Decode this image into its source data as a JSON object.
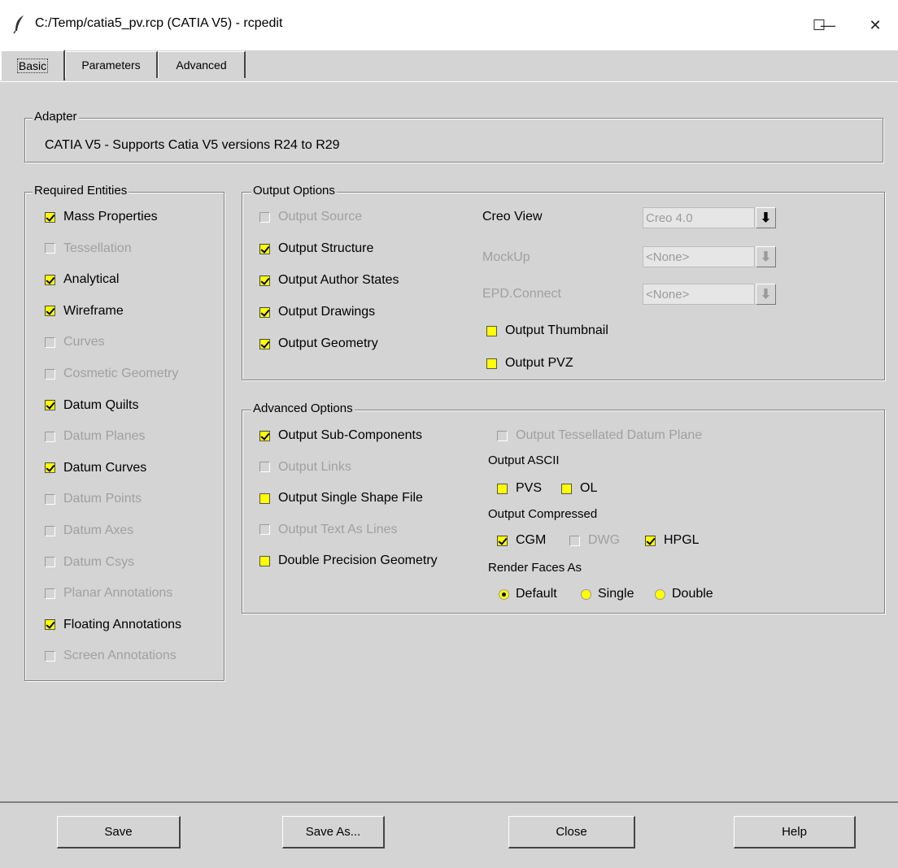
{
  "window": {
    "title": "C:/Temp/catia5_pv.rcp (CATIA V5) - rcpedit",
    "minimize": "—",
    "maximize": "☐",
    "close": "✕"
  },
  "tabs": [
    "Basic",
    "Parameters",
    "Advanced"
  ],
  "active_tab": "Basic",
  "adapter": {
    "label": "Adapter",
    "text": "CATIA V5  -  Supports Catia V5 versions R24 to R29"
  },
  "required_entities": {
    "label": "Required Entities",
    "items": [
      {
        "label": "Mass Properties",
        "checked": true,
        "enabled": true
      },
      {
        "label": "Tessellation",
        "checked": false,
        "enabled": false
      },
      {
        "label": "Analytical",
        "checked": true,
        "enabled": true
      },
      {
        "label": "Wireframe",
        "checked": true,
        "enabled": true
      },
      {
        "label": "Curves",
        "checked": false,
        "enabled": false
      },
      {
        "label": "Cosmetic Geometry",
        "checked": false,
        "enabled": false
      },
      {
        "label": "Datum Quilts",
        "checked": true,
        "enabled": true
      },
      {
        "label": "Datum Planes",
        "checked": false,
        "enabled": false
      },
      {
        "label": "Datum Curves",
        "checked": true,
        "enabled": true
      },
      {
        "label": "Datum Points",
        "checked": false,
        "enabled": false
      },
      {
        "label": "Datum Axes",
        "checked": false,
        "enabled": false
      },
      {
        "label": "Datum Csys",
        "checked": false,
        "enabled": false
      },
      {
        "label": "Planar Annotations",
        "checked": false,
        "enabled": false
      },
      {
        "label": "Floating Annotations",
        "checked": true,
        "enabled": true
      },
      {
        "label": "Screen Annotations",
        "checked": false,
        "enabled": false
      }
    ]
  },
  "output_options": {
    "label": "Output Options",
    "items": [
      {
        "label": "Output Source",
        "checked": false,
        "enabled": false
      },
      {
        "label": "Output Structure",
        "checked": true,
        "enabled": true
      },
      {
        "label": "Output Author States",
        "checked": true,
        "enabled": true
      },
      {
        "label": "Output Drawings",
        "checked": true,
        "enabled": true
      },
      {
        "label": "Output Geometry",
        "checked": true,
        "enabled": true
      }
    ],
    "creo_view": {
      "label": "Creo View",
      "value": "Creo 4.0"
    },
    "mockup": {
      "label": "MockUp",
      "value": "<None>"
    },
    "epd_connect": {
      "label": "EPD.Connect",
      "value": "<None>"
    },
    "output_thumbnail": {
      "label": "Output Thumbnail",
      "checked": false
    },
    "output_pvz": {
      "label": "Output PVZ",
      "checked": false
    },
    "download_icon": "⬇"
  },
  "advanced_options": {
    "label": "Advanced Options",
    "items": [
      {
        "label": "Output Sub-Components",
        "checked": true,
        "enabled": true
      },
      {
        "label": "Output Links",
        "checked": false,
        "enabled": false
      },
      {
        "label": "Output Single Shape File",
        "checked": false,
        "enabled": true
      },
      {
        "label": "Output Text As Lines",
        "checked": false,
        "enabled": false
      },
      {
        "label": "Double Precision Geometry",
        "checked": false,
        "enabled": true
      }
    ],
    "tess_datum_plane": {
      "label": "Output Tessellated Datum Plane",
      "checked": false
    },
    "output_ascii": {
      "label": "Output ASCII",
      "pvs": {
        "label": "PVS",
        "checked": false
      },
      "ol": {
        "label": "OL",
        "checked": false
      }
    },
    "output_compressed": {
      "label": "Output Compressed",
      "cgm": {
        "label": "CGM",
        "checked": true
      },
      "dwg": {
        "label": "DWG",
        "checked": false
      },
      "hpgl": {
        "label": "HPGL",
        "checked": true
      }
    },
    "render_faces": {
      "label": "Render Faces As",
      "options": [
        "Default",
        "Single",
        "Double"
      ],
      "selected": "Default"
    }
  },
  "buttons": {
    "save": "Save",
    "save_as": "Save As...",
    "close": "Close",
    "help": "Help"
  }
}
